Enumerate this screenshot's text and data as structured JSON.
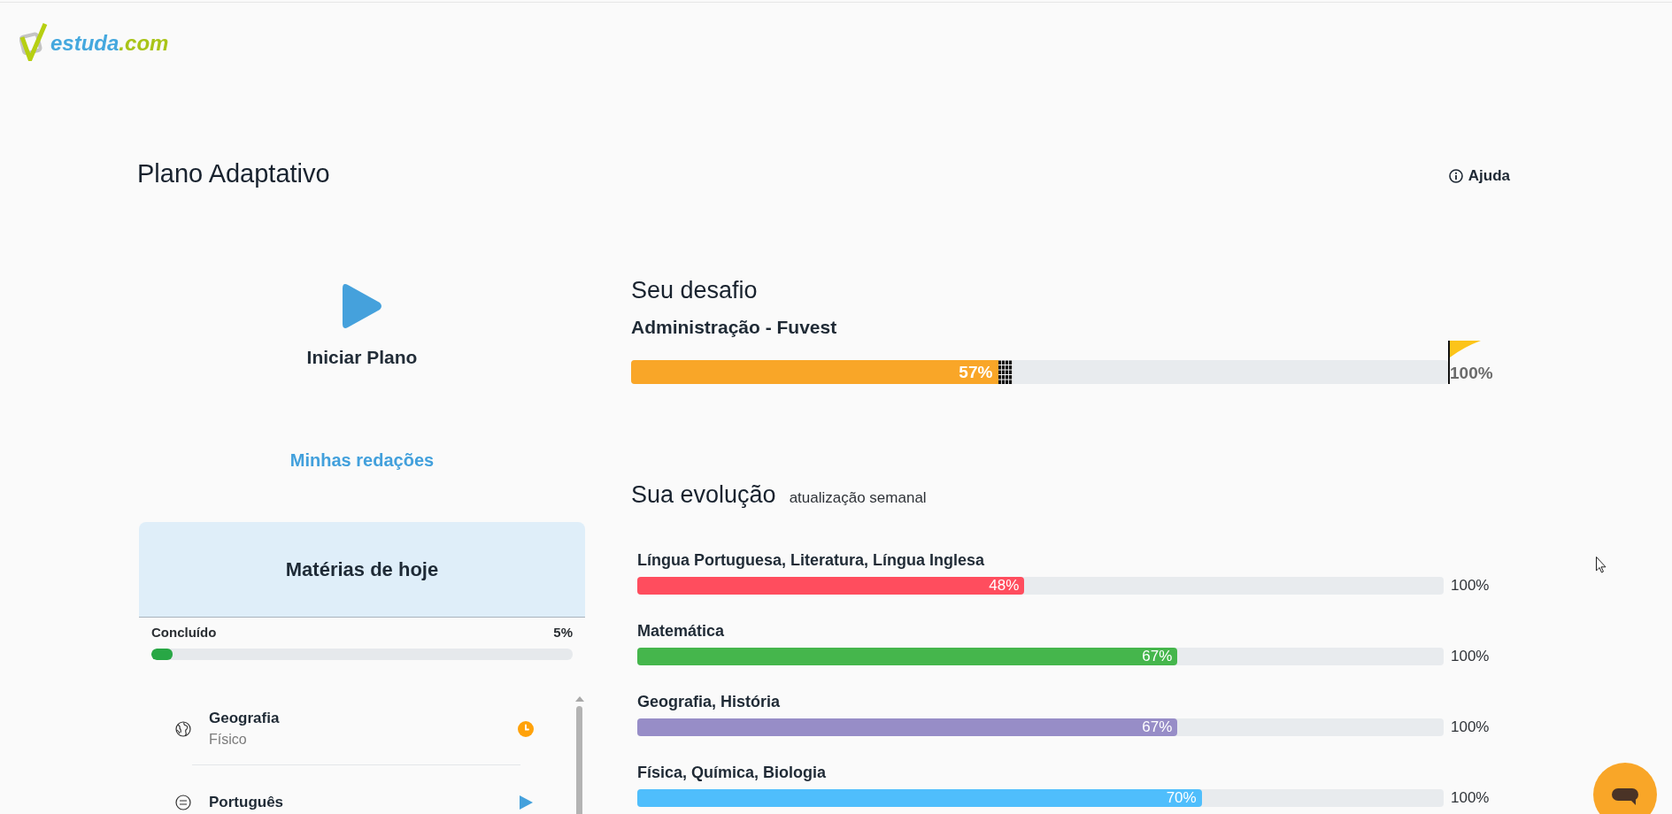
{
  "header": {
    "logo": {
      "name": "estuda",
      "suffix": ".com"
    }
  },
  "page": {
    "title": "Plano Adaptativo",
    "help": "Ajuda"
  },
  "plan": {
    "start": "Iniciar Plano",
    "essays": "Minhas redações"
  },
  "today": {
    "title": "Matérias de hoje",
    "progress_label": "Concluído",
    "reading": "5%",
    "level": 0.05,
    "subjects": [
      {
        "name": "Geografia",
        "topic": "Físico",
        "kind": "geography",
        "in_progress": true
      },
      {
        "name": "Português",
        "kind": "language",
        "in_progress": false
      }
    ]
  },
  "challenge": {
    "title": "Seu desafio",
    "goal": "Administração - Fuvest",
    "level": 0.45,
    "reading": "57%",
    "target": "100%"
  },
  "evolution": {
    "title": "Sua evolução",
    "note": "atualização semanal",
    "subjects": [
      {
        "name": "Língua Portuguesa, Literatura, Língua Inglesa",
        "level": 0.48,
        "reading": "48%",
        "max": "100%",
        "color": "#ff4d5e"
      },
      {
        "name": "Matemática",
        "level": 0.67,
        "reading": "67%",
        "max": "100%",
        "color": "#45b64c"
      },
      {
        "name": "Geografia, História",
        "level": 0.67,
        "reading": "67%",
        "max": "100%",
        "color": "#978dc7"
      },
      {
        "name": "Física, Química, Biologia",
        "level": 0.7,
        "reading": "70%",
        "max": "100%",
        "color": "#4fbefc"
      }
    ]
  }
}
